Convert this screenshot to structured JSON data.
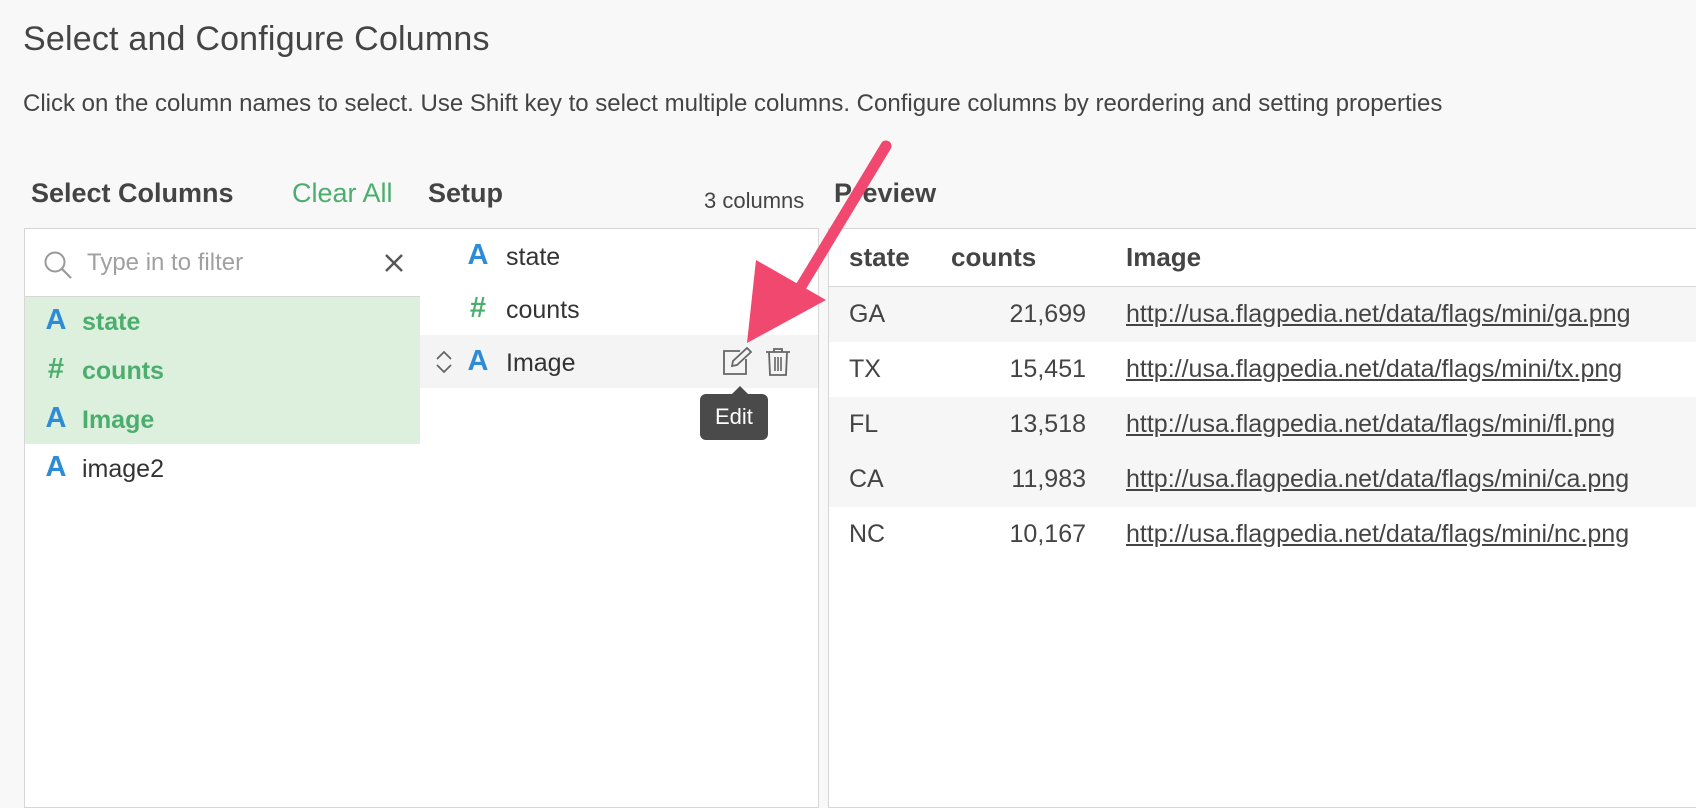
{
  "header": {
    "title": "Select and Configure Columns",
    "description": "Click on the column names to select. Use Shift key to select multiple columns. Configure columns by reordering and setting properties"
  },
  "select_columns": {
    "heading": "Select Columns",
    "clear_all": "Clear All",
    "filter_placeholder": "Type in to filter",
    "items": [
      {
        "label": "state",
        "type": "A",
        "selected": true
      },
      {
        "label": "counts",
        "type": "#",
        "selected": true
      },
      {
        "label": "Image",
        "type": "A",
        "selected": true
      },
      {
        "label": "image2",
        "type": "A",
        "selected": false
      }
    ]
  },
  "setup": {
    "heading": "Setup",
    "count_label": "3 columns",
    "items": [
      {
        "label": "state",
        "type": "A"
      },
      {
        "label": "counts",
        "type": "#"
      },
      {
        "label": "Image",
        "type": "A"
      }
    ],
    "tooltip": "Edit"
  },
  "preview": {
    "heading": "Preview",
    "columns": [
      "state",
      "counts",
      "Image"
    ],
    "rows": [
      {
        "state": "GA",
        "counts": "21,699",
        "image": "http://usa.flagpedia.net/data/flags/mini/ga.png"
      },
      {
        "state": "TX",
        "counts": "15,451",
        "image": "http://usa.flagpedia.net/data/flags/mini/tx.png"
      },
      {
        "state": "FL",
        "counts": "13,518",
        "image": "http://usa.flagpedia.net/data/flags/mini/fl.png"
      },
      {
        "state": "CA",
        "counts": "11,983",
        "image": "http://usa.flagpedia.net/data/flags/mini/ca.png"
      },
      {
        "state": "NC",
        "counts": "10,167",
        "image": "http://usa.flagpedia.net/data/flags/mini/nc.png"
      }
    ]
  },
  "icons": {
    "type_a": "type-a-icon",
    "type_number": "type-number-icon",
    "search": "search-icon",
    "close": "close-icon",
    "drag": "drag-handle-icon",
    "edit": "edit-icon",
    "trash": "trash-icon"
  },
  "colors": {
    "accent_green": "#4cae6e",
    "selected_bg": "#ddf0dd",
    "type_a_blue": "#2e8bd6",
    "arrow_pink": "#f0486e",
    "tooltip_bg": "#4a4a4a"
  }
}
